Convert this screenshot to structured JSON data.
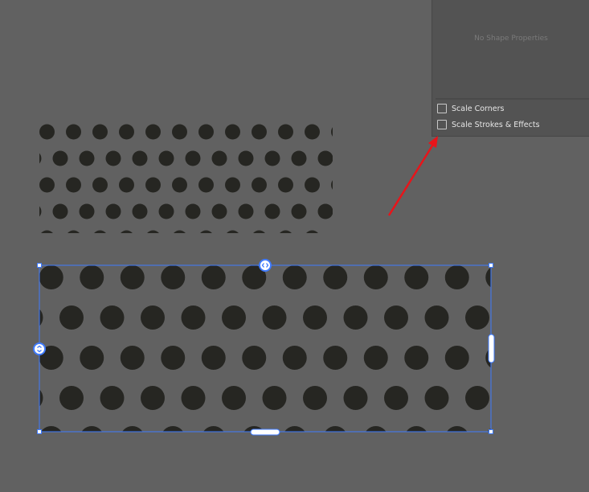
{
  "panel": {
    "empty_message": "No Shape Properties",
    "options": [
      {
        "label": "Scale Corners",
        "checked": false
      },
      {
        "label": "Scale Strokes & Effects",
        "checked": false
      }
    ]
  },
  "colors": {
    "canvas": "#616161",
    "panel": "#535353",
    "dot": "#262622",
    "selection": "#3f7bff",
    "arrow": "#e8141a"
  }
}
